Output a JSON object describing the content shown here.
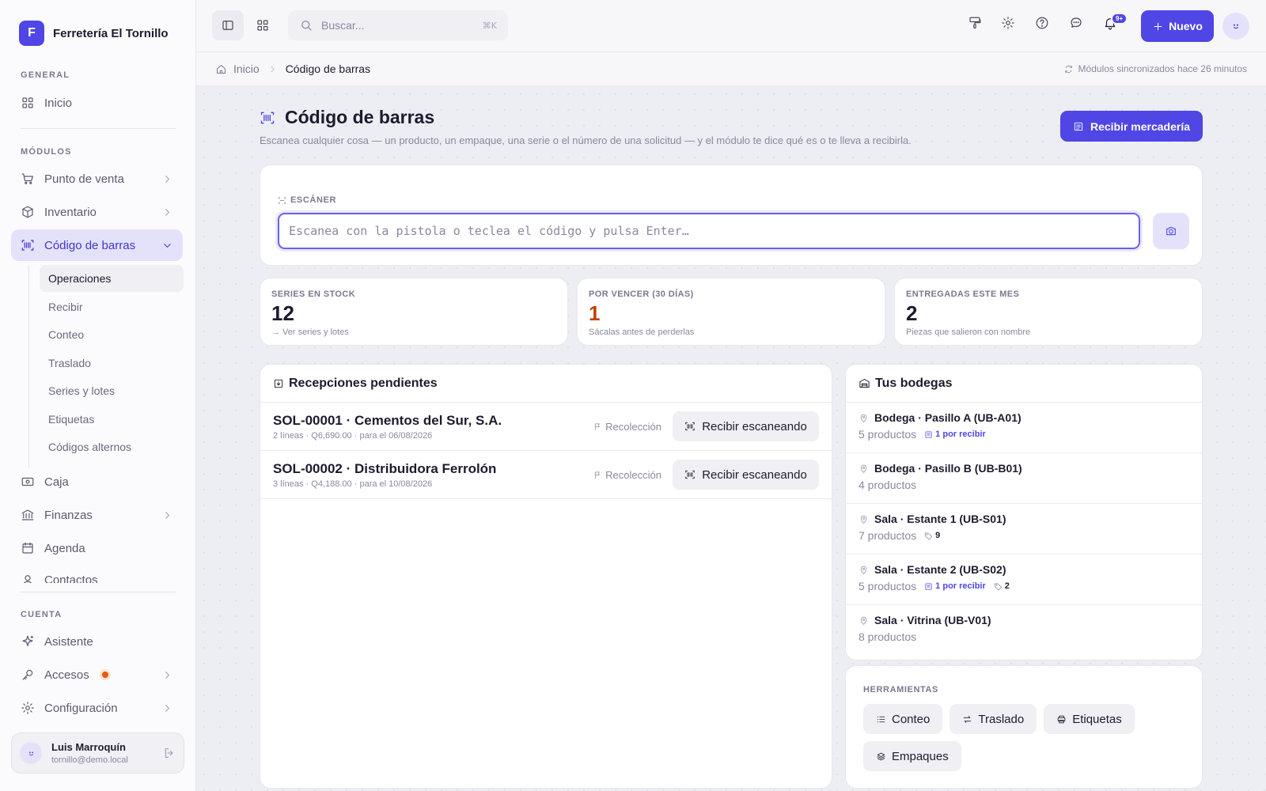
{
  "app": {
    "logo_letter": "F",
    "name": "Ferretería El Tornillo"
  },
  "sidebar": {
    "section_general": "GENERAL",
    "inicio": "Inicio",
    "section_modulos": "MÓDULOS",
    "modules": [
      {
        "label": "Punto de venta",
        "icon": "cart-icon"
      },
      {
        "label": "Inventario",
        "icon": "box-icon"
      },
      {
        "label": "Código de barras",
        "icon": "barcode-icon"
      }
    ],
    "subitems": [
      "Operaciones",
      "Recibir",
      "Conteo",
      "Traslado",
      "Series y lotes",
      "Etiquetas",
      "Códigos alternos"
    ],
    "more": [
      {
        "label": "Caja",
        "icon": "cash-icon"
      },
      {
        "label": "Finanzas",
        "icon": "bank-icon"
      },
      {
        "label": "Agenda",
        "icon": "calendar-icon"
      },
      {
        "label": "Contactos",
        "icon": "contacts-icon"
      }
    ],
    "section_cuenta": "CUENTA",
    "account": [
      {
        "label": "Asistente",
        "icon": "sparkle-icon"
      },
      {
        "label": "Accesos",
        "icon": "key-icon"
      },
      {
        "label": "Configuración",
        "icon": "gear-icon"
      }
    ],
    "user": {
      "name": "Luis Marroquín",
      "email": "tornillo@demo.local"
    }
  },
  "topbar": {
    "search_placeholder": "Buscar...",
    "search_shortcut": "⌘K",
    "notifications_badge": "9+",
    "new_button": "Nuevo"
  },
  "breadcrumb": {
    "home": "Inicio",
    "current": "Código de barras",
    "sync": "Módulos sincronizados hace 26 minutos"
  },
  "page": {
    "title": "Código de barras",
    "subtitle": "Escanea cualquier cosa — un producto, un empaque, una serie o el número de una solicitud — y el módulo te dice qué es o te lleva a recibirla.",
    "primary_action": "Recibir mercadería"
  },
  "scanner": {
    "label": "ESCÁNER",
    "placeholder": "Escanea con la pistola o teclea el código y pulsa Enter…"
  },
  "stats": [
    {
      "label": "SERIES EN STOCK",
      "value": "12",
      "foot": "Ver series y lotes",
      "arrow": "→"
    },
    {
      "label": "POR VENCER (30 DÍAS)",
      "value": "1",
      "foot": "Sácalas antes de perderlas"
    },
    {
      "label": "ENTREGADAS ESTE MES",
      "value": "2",
      "foot": "Piezas que salieron con nombre"
    }
  ],
  "pending": {
    "title": "Recepciones pendientes",
    "rows": [
      {
        "title": "SOL-00001 · Cementos del Sur, S.A.",
        "meta": "2 líneas · Q6,690.00 · para el 06/08/2026",
        "tag": "Recolección",
        "action": "Recibir escaneando"
      },
      {
        "title": "SOL-00002 · Distribuidora Ferrolón",
        "meta": "3 líneas · Q4,188.00 · para el 10/08/2026",
        "tag": "Recolección",
        "action": "Recibir escaneando"
      }
    ]
  },
  "bodegas": {
    "title": "Tus bodegas",
    "rows": [
      {
        "name": "Bodega · Pasillo A (UB-A01)",
        "count": "5 productos",
        "pending": "1 por recibir",
        "series": ""
      },
      {
        "name": "Bodega · Pasillo B (UB-B01)",
        "count": "4 productos",
        "pending": "",
        "series": ""
      },
      {
        "name": "Sala · Estante 1 (UB-S01)",
        "count": "7 productos",
        "pending": "",
        "series": "9"
      },
      {
        "name": "Sala · Estante 2 (UB-S02)",
        "count": "5 productos",
        "pending": "1 por recibir",
        "series": "2"
      },
      {
        "name": "Sala · Vitrina (UB-V01)",
        "count": "8 productos",
        "pending": "",
        "series": ""
      }
    ]
  },
  "tools": {
    "label": "HERRAMIENTAS",
    "items": [
      {
        "label": "Conteo",
        "icon": "list-icon"
      },
      {
        "label": "Traslado",
        "icon": "swap-icon"
      },
      {
        "label": "Etiquetas",
        "icon": "printer-icon"
      },
      {
        "label": "Empaques",
        "icon": "layers-icon"
      }
    ]
  },
  "colors": {
    "accent": "#4f46e5",
    "accent_soft": "#e4e2fb",
    "warning": "#c2410c",
    "alert_dot": "#e8590c"
  }
}
